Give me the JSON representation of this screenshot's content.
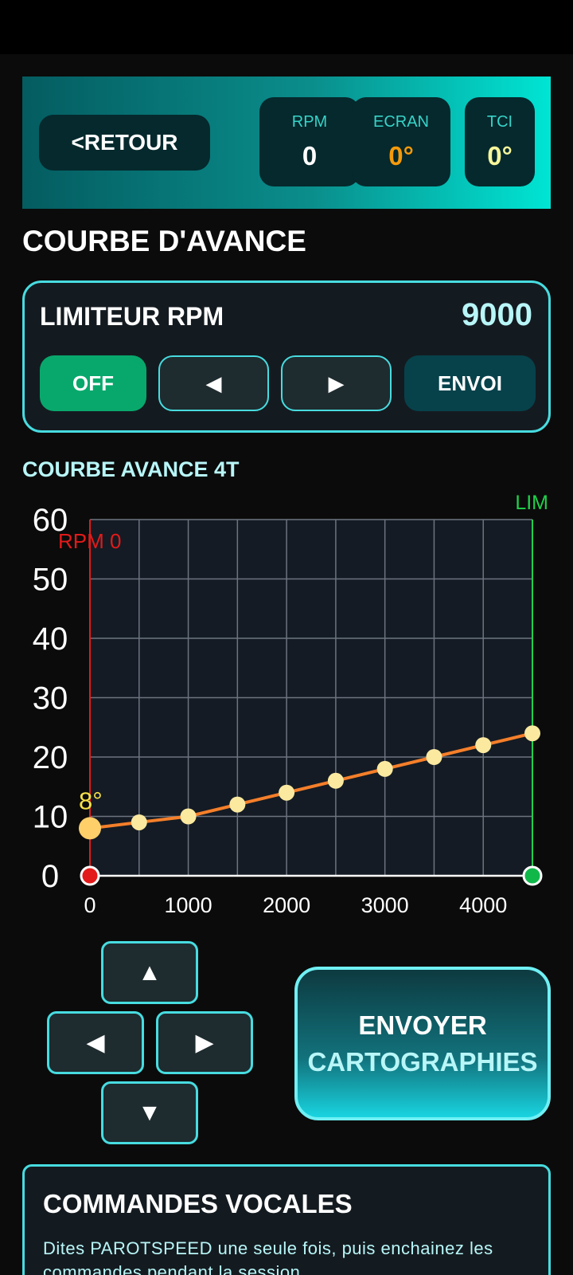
{
  "header": {
    "back_label": "<RETOUR",
    "stats": [
      {
        "label": "RPM",
        "value": "0",
        "color": "#ffffff"
      },
      {
        "label": "ECRAN",
        "value": "0°",
        "color": "#f59a0a"
      },
      {
        "label": "TCI",
        "value": "0°",
        "color": "#f6f59a"
      }
    ]
  },
  "section_title": "COURBE D'AVANCE",
  "limiter": {
    "label": "LIMITEUR RPM",
    "value": "9000",
    "buttons": {
      "off": "OFF",
      "left": "◀",
      "right": "▶",
      "send": "ENVOI"
    }
  },
  "chart_title": "COURBE AVANCE 4T",
  "chart_data": {
    "type": "line",
    "x": [
      0,
      500,
      1000,
      1500,
      2000,
      2500,
      3000,
      3500,
      4000,
      4500
    ],
    "values": [
      8,
      9,
      10,
      12,
      14,
      16,
      18,
      20,
      22,
      24
    ],
    "xlim": [
      0,
      4500
    ],
    "ylim": [
      0,
      60
    ],
    "x_ticks": [
      0,
      1000,
      2000,
      3000,
      4000
    ],
    "y_ticks": [
      0,
      10,
      20,
      30,
      40,
      50,
      60
    ],
    "grid": true,
    "line_color": "#f57f2a",
    "point_color": "#fbe9a0",
    "selected_index": 0,
    "selected_label": "8°",
    "current_marker": {
      "label": "RPM 0",
      "x": 0,
      "color": "#e31a1a"
    },
    "limit_marker": {
      "label": "LIM",
      "x": 4500,
      "color": "#1fd14a"
    }
  },
  "dpad": {
    "up": "▲",
    "left": "◀",
    "right": "▶",
    "down": "▼"
  },
  "send_maps": {
    "line1": "ENVOYER",
    "line2": "CARTOGRAPHIES"
  },
  "voice": {
    "title": "COMMANDES VOCALES",
    "text": "Dites PAROTSPEED une seule fois, puis enchainez les commandes pendant la session."
  }
}
